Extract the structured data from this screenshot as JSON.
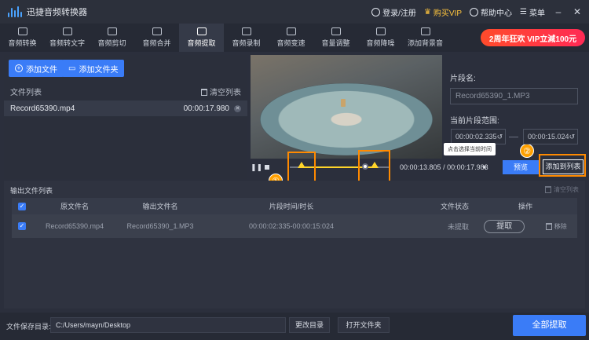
{
  "app": {
    "title": "迅捷音频转换器"
  },
  "topbar": {
    "login": "登录/注册",
    "vip": "购买VIP",
    "help": "帮助中心",
    "menu": "菜单"
  },
  "toolbar": {
    "items": [
      {
        "label": "音频转换",
        "icon": "refresh-icon"
      },
      {
        "label": "音频转文字",
        "icon": "text-convert-icon"
      },
      {
        "label": "音频剪切",
        "icon": "scissors-icon"
      },
      {
        "label": "音频合并",
        "icon": "merge-icon"
      },
      {
        "label": "音频提取",
        "icon": "extract-icon"
      },
      {
        "label": "音频录制",
        "icon": "microphone-icon"
      },
      {
        "label": "音频变速",
        "icon": "speed-icon"
      },
      {
        "label": "音量调整",
        "icon": "volume-icon"
      },
      {
        "label": "音频降噪",
        "icon": "noise-reduce-icon"
      },
      {
        "label": "添加背景音",
        "icon": "music-note-icon"
      }
    ],
    "active_index": 4,
    "promo": "2周年狂欢 VIP立減100元"
  },
  "files": {
    "add_file": "添加文件",
    "add_folder": "添加文件夹",
    "list_title": "文件列表",
    "clear": "清空列表",
    "rows": [
      {
        "name": "Record65390.mp4",
        "duration": "00:00:17.980"
      }
    ]
  },
  "player": {
    "current": "00:00:13.805",
    "separator": " / ",
    "total": "00:00:17.983",
    "position_fraction": 0.77,
    "segment_start_fraction": 0.125,
    "segment_end_fraction": 0.845
  },
  "segment": {
    "name_label": "片段名:",
    "name_value": "Record65390_1.MP3",
    "range_label": "当前片段范围:",
    "start": "00:00:02.335",
    "end": "00:00:15.024",
    "tooltip": "点击选择当前时间",
    "preview": "预览",
    "add_to_list": "添加到列表"
  },
  "annotations": [
    "①",
    "②",
    "③"
  ],
  "output": {
    "title": "输出文件列表",
    "clear": "清空列表",
    "headers": [
      "原文件名",
      "输出文件名",
      "片段时间/时长",
      "文件状态",
      "操作"
    ],
    "rows": [
      {
        "source": "Record65390.mp4",
        "output": "Record65390_1.MP3",
        "range": "00:00:02:335-00:00:15:024",
        "status": "未提取",
        "action": "提取",
        "remove": "移除"
      }
    ]
  },
  "footer": {
    "save_label": "文件保存目录:",
    "save_path": "C:/Users/mayn/Desktop",
    "change_dir": "更改目录",
    "open_folder": "打开文件夹",
    "extract_all": "全部提取"
  },
  "colors": {
    "accent": "#3a7cf7",
    "annotation": "#ff8a00",
    "segment": "#ffd42a",
    "promo": "#ff3a3a"
  }
}
